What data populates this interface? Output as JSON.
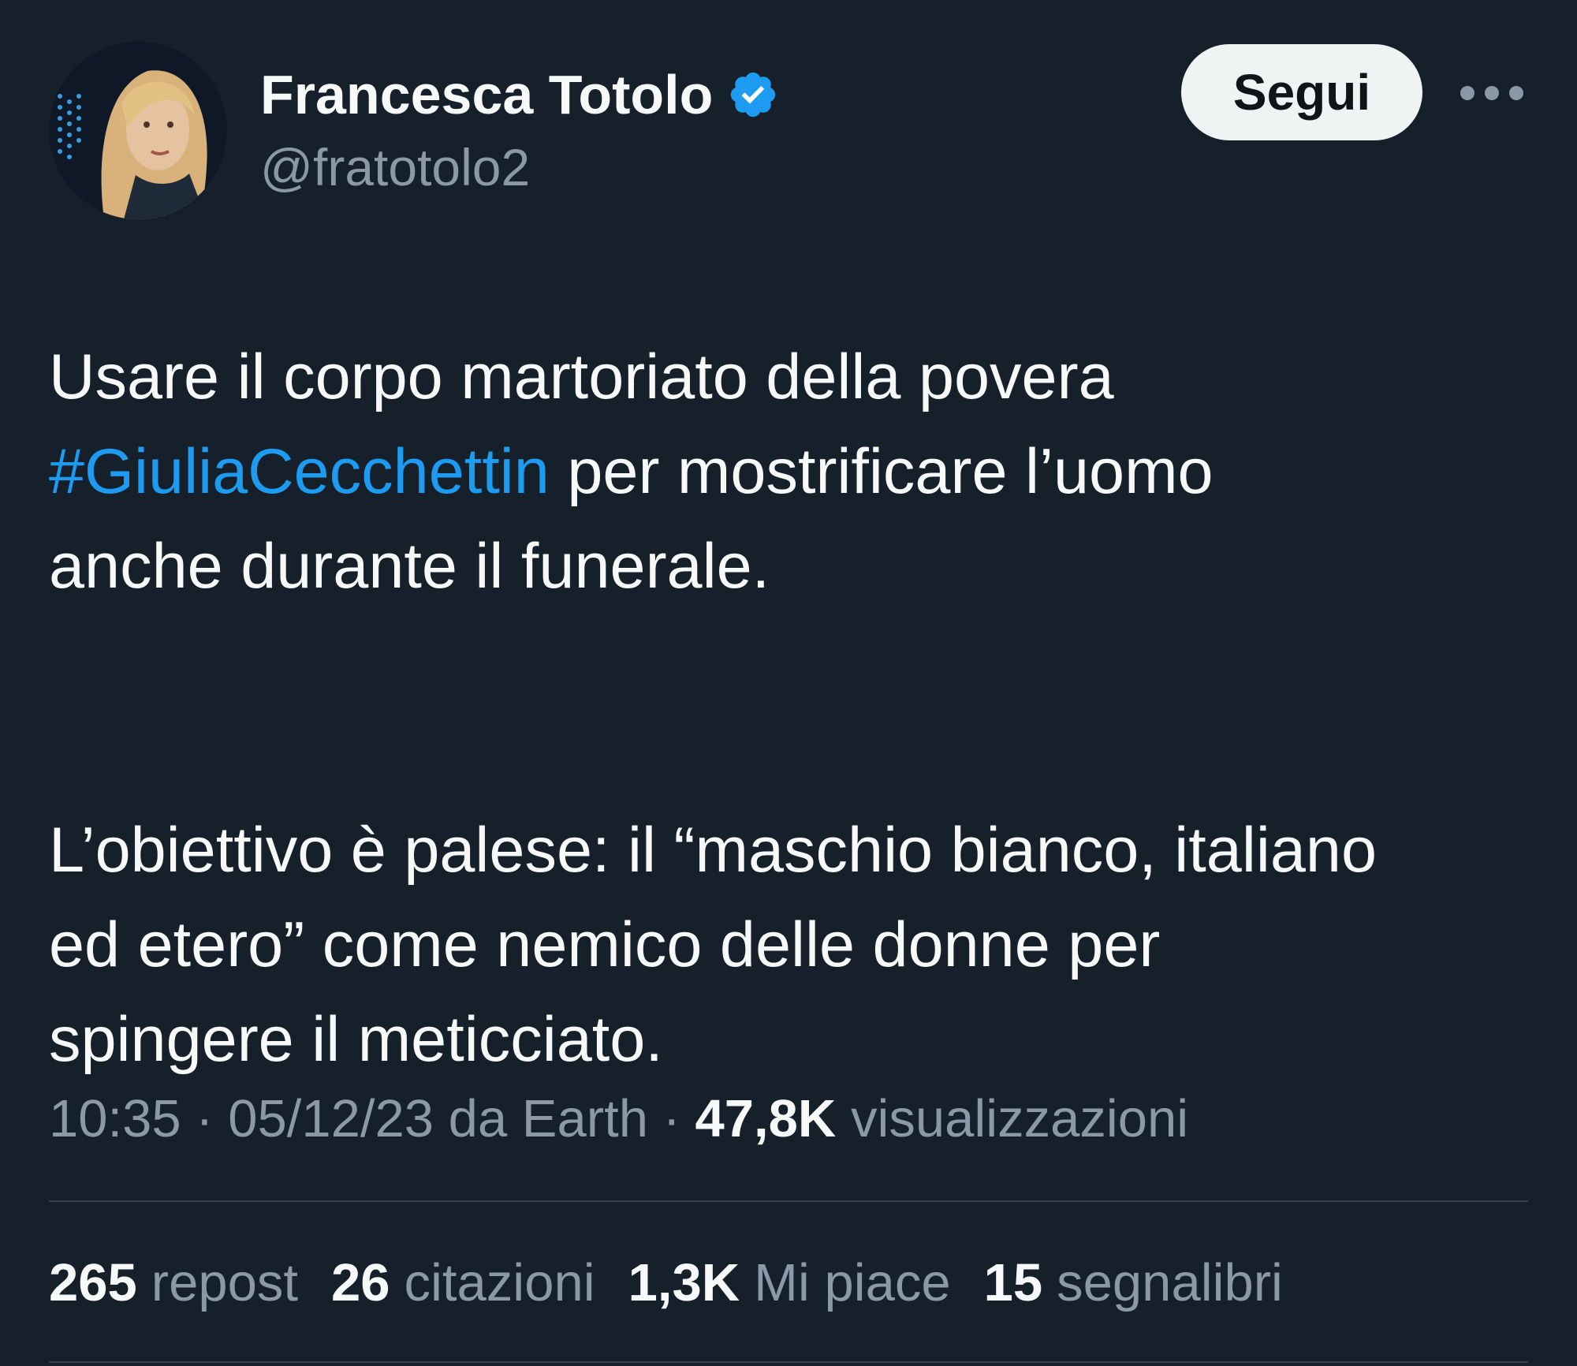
{
  "author": {
    "display_name": "Francesca Totolo",
    "handle": "@fratotolo2",
    "verified": true
  },
  "follow_label": "Segui",
  "tweet": {
    "line1": "Usare il corpo martoriato della povera",
    "hashtag": "#GiuliaCecchettin",
    "line2_rest": " per mostrificare l’uomo",
    "line3": "anche durante il funerale.",
    "line4": "L’obiettivo è palese: il “maschio bianco, italiano",
    "line5": "ed etero” come nemico delle donne per",
    "line6": "spingere il meticciato."
  },
  "meta": {
    "time": "10:35",
    "date": "05/12/23",
    "source": "da Earth",
    "views_count": "47,8K",
    "views_label": "visualizzazioni"
  },
  "stats": {
    "reposts_count": "265",
    "reposts_label": "repost",
    "quotes_count": "26",
    "quotes_label": "citazioni",
    "likes_count": "1,3K",
    "likes_label": "Mi piace",
    "bookmarks_count": "15",
    "bookmarks_label": "segnalibri"
  },
  "colors": {
    "background": "#15202b",
    "accent": "#1d9bf0",
    "text_primary": "#f7f9f9",
    "text_secondary": "#8b98a5"
  }
}
